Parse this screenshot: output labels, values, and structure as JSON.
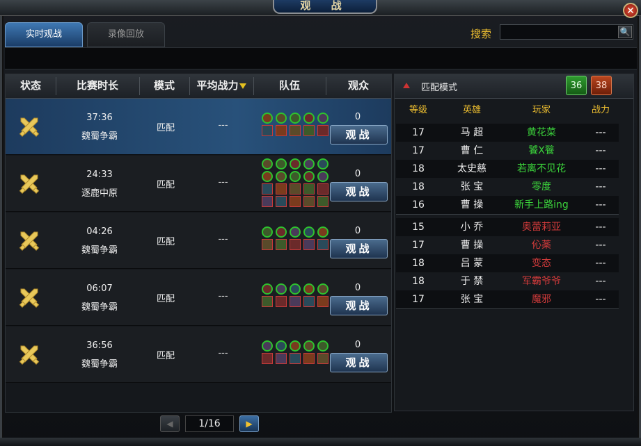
{
  "window": {
    "title": "观 战",
    "close_label": "✕"
  },
  "tabs": [
    {
      "label": "实时观战",
      "active": true
    },
    {
      "label": "录像回放",
      "active": false
    }
  ],
  "search": {
    "label": "搜索",
    "value": "",
    "placeholder": "",
    "icon": "search-icon"
  },
  "table": {
    "headers": {
      "status": "状态",
      "duration": "比赛时长",
      "mode": "模式",
      "power": "平均战力",
      "team": "队伍",
      "viewers": "观众"
    },
    "rows": [
      {
        "time": "37:36",
        "map": "魏蜀争霸",
        "mode": "匹配",
        "power": "---",
        "viewers": "0",
        "button": "观战",
        "team_icons": [
          "g",
          "g",
          "g",
          "g",
          "g",
          "s",
          "s",
          "s",
          "s",
          "s"
        ]
      },
      {
        "time": "24:33",
        "map": "逐鹿中原",
        "mode": "匹配",
        "power": "---",
        "viewers": "0",
        "button": "观战",
        "team_icons": [
          "g",
          "g",
          "g",
          "g",
          "g",
          "g",
          "g",
          "g",
          "g",
          "g",
          "s",
          "s",
          "s",
          "s",
          "s",
          "s",
          "s",
          "s",
          "s",
          "s"
        ]
      },
      {
        "time": "04:26",
        "map": "魏蜀争霸",
        "mode": "匹配",
        "power": "---",
        "viewers": "0",
        "button": "观战",
        "team_icons": [
          "g",
          "g",
          "g",
          "g",
          "g",
          "s",
          "s",
          "s",
          "s",
          "s"
        ]
      },
      {
        "time": "06:07",
        "map": "魏蜀争霸",
        "mode": "匹配",
        "power": "---",
        "viewers": "0",
        "button": "观战",
        "team_icons": [
          "g",
          "g",
          "g",
          "g",
          "g",
          "s",
          "s",
          "s",
          "s",
          "s"
        ]
      },
      {
        "time": "36:56",
        "map": "魏蜀争霸",
        "mode": "匹配",
        "power": "---",
        "viewers": "0",
        "button": "观战",
        "team_icons": [
          "g",
          "g",
          "g",
          "g",
          "g",
          "s",
          "s",
          "s",
          "s",
          "s"
        ]
      }
    ]
  },
  "detail": {
    "mode_label": "匹配模式",
    "score_green": "36",
    "score_red": "38",
    "headers": {
      "level": "等级",
      "hero": "英雄",
      "player": "玩家",
      "power": "战力"
    },
    "green_team": [
      {
        "level": "17",
        "hero": "马 超",
        "player": "黄花菜",
        "power": "---"
      },
      {
        "level": "17",
        "hero": "曹 仁",
        "player": "饕X餮",
        "power": "---"
      },
      {
        "level": "18",
        "hero": "太史慈",
        "player": "若离不见花",
        "power": "---"
      },
      {
        "level": "18",
        "hero": "张 宝",
        "player": "零度",
        "power": "---"
      },
      {
        "level": "16",
        "hero": "曹 操",
        "player": "新手上路ing",
        "power": "---"
      }
    ],
    "red_team": [
      {
        "level": "15",
        "hero": "小 乔",
        "player": "奥蕾莉亚",
        "power": "---"
      },
      {
        "level": "17",
        "hero": "曹 操",
        "player": "伈薬",
        "power": "---"
      },
      {
        "level": "18",
        "hero": "吕 蒙",
        "player": "变态",
        "power": "---"
      },
      {
        "level": "18",
        "hero": "于 禁",
        "player": "军霸爷爷",
        "power": "---"
      },
      {
        "level": "17",
        "hero": "张 宝",
        "player": "魔邪",
        "power": "---"
      }
    ]
  },
  "pager": {
    "current": "1/16"
  },
  "colors": {
    "accent_blue": "#28517a",
    "green_team": "#3bd23b",
    "red_team": "#d23b3b",
    "header_gold": "#f0c030"
  }
}
